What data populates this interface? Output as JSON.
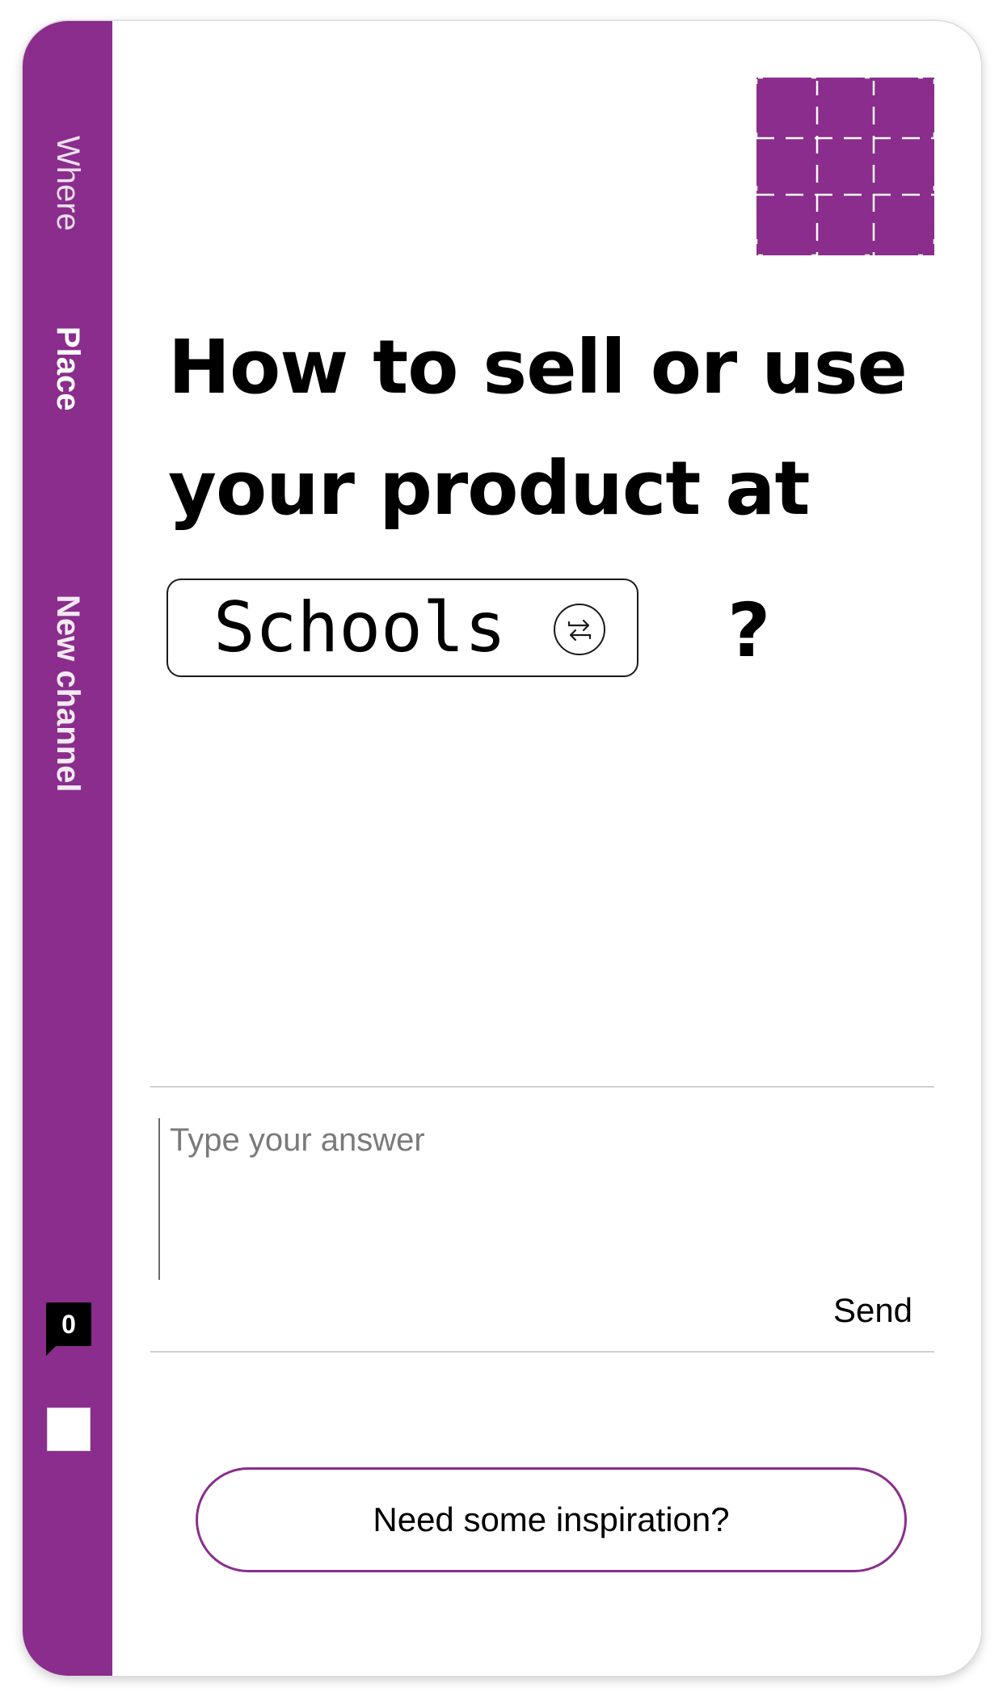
{
  "sidebar": {
    "steps": [
      {
        "label": "Where"
      },
      {
        "label": "Place"
      },
      {
        "label": "New channel"
      }
    ],
    "counter": "0"
  },
  "question": {
    "text": "How to sell or use your product at",
    "selected_place": "Schools",
    "suffix": "?"
  },
  "answer": {
    "value": "",
    "placeholder": "Type your answer"
  },
  "send_label": "Send",
  "inspiration_label": "Need some inspiration?",
  "colors": {
    "accent": "#8a2d8c",
    "text": "#000000",
    "divider": "#cfcfcf"
  },
  "icons": [
    "grid-pattern-logo-icon",
    "swap-icon"
  ]
}
